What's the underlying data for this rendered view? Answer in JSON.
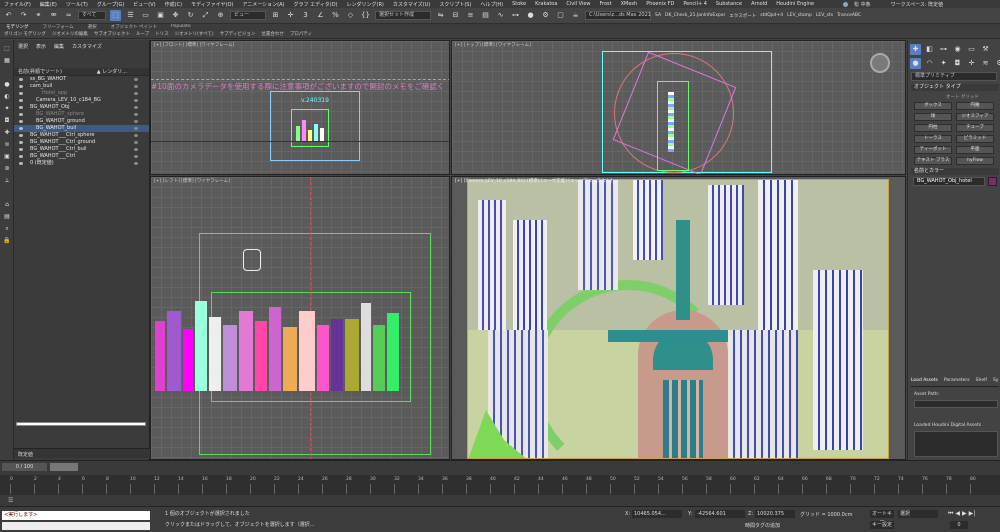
{
  "menu": [
    "ファイル(F)",
    "編集(E)",
    "ツール(T)",
    "グループ(G)",
    "ビュー(V)",
    "作成(C)",
    "モディファイヤ(O)",
    "アニメーション(A)",
    "グラフ エディタ(D)",
    "レンダリング(R)",
    "カスタマイズ(U)",
    "スクリプト(S)",
    "ヘルプ(H)",
    "Stoke",
    "Krakatoa",
    "Civil View",
    "Frost",
    "XMesh",
    "Phoenix FD",
    "Pencil+ 4",
    "Substance",
    "Arnold",
    "Houdini Engine"
  ],
  "user": "松 中条",
  "workspace_label": "ワークスペース: 既定値",
  "toolbar": {
    "filter_value": "すべて",
    "view_value": "ビュー",
    "selection_set_placeholder": "選択セット作成",
    "path_value": "C:\\Users\\z...ds Max 2021",
    "tabs": [
      "SA",
      "DK_Check_21.JanInfoExpor",
      "エクスポート",
      "stdQpd+4",
      "LEV_stamp",
      "LEV_sts",
      "TranceABC"
    ]
  },
  "ribbon": [
    "モデリング",
    "フリーフォーム",
    "選択",
    "オブジェクト ペイント",
    "Populate"
  ],
  "ribbon2": [
    "ポリゴン モデリング",
    "ジオメトリの編集",
    "サブオブジェクト",
    "ループ",
    "トリス",
    "ジオメトリ(すべて)",
    "サブディビジョン",
    "位置合わせ",
    "プロパティ"
  ],
  "explorer": {
    "tabs": [
      "選択",
      "表示",
      "編集",
      "カスタマイズ"
    ],
    "header": "名前(昇順でソート)",
    "header_right": "▲ レンダリ...",
    "rows": [
      {
        "label": "ss_BG_WAHOT",
        "indent": 1,
        "selected": false,
        "eye": true
      },
      {
        "label": "cam_buil",
        "indent": 1,
        "selected": false,
        "eye": true
      },
      {
        "label": "Hotel_app",
        "indent": 3,
        "selected": false,
        "eye": false
      },
      {
        "label": "Camera_LEV_10_c184_BG",
        "indent": 2,
        "selected": false,
        "eye": true
      },
      {
        "label": "BG_WAHOT_Obj",
        "indent": 1,
        "selected": false,
        "eye": true
      },
      {
        "label": "BG_WAHOT_sphere",
        "indent": 2,
        "selected": false,
        "eye": false
      },
      {
        "label": "BG_WAHOT_ground",
        "indent": 2,
        "selected": false,
        "eye": true
      },
      {
        "label": "BG_WAHOT_buil",
        "indent": 2,
        "selected": true,
        "eye": true
      },
      {
        "label": "BG_WAHOT___Ctrl_sphere",
        "indent": 1,
        "selected": false,
        "eye": true
      },
      {
        "label": "BG_WAHOT___Ctrl_ground",
        "indent": 1,
        "selected": false,
        "eye": true
      },
      {
        "label": "BG_WAHOT___Ctrl_buil",
        "indent": 1,
        "selected": false,
        "eye": true
      },
      {
        "label": "BG_WAHOT___Ctrl",
        "indent": 1,
        "selected": false,
        "eye": true
      },
      {
        "label": "0 (既定値)",
        "indent": 1,
        "selected": false,
        "eye": true
      }
    ],
    "layer_label": "既定値"
  },
  "viewports": {
    "front": {
      "label": "[+] [フロント] [標準] [ワイヤフレーム]",
      "warning": "#10面のカメラデータを使用する際に注意事項がございますので開封のメモをご確認く",
      "version": "v.240319"
    },
    "top": {
      "label": "[+] [トップ] [標準] [ワイヤフレーム]"
    },
    "left": {
      "label": "[+] [レフト] [標準] [ワイヤフレーム]"
    },
    "camera": {
      "label": "[+] [Camera_LEV_10_c184_BG] [標準] [ユーザ定義] [エッジフェースなし]"
    }
  },
  "command_panel": {
    "category": "標準プリミティブ",
    "object_type_header": "オブジェクト タイプ",
    "autogrid": "オート グリッド",
    "buttons": [
      "ボックス",
      "円錐",
      "球",
      "ジオスフィア",
      "円柱",
      "チューブ",
      "トーラス",
      "ピラミッド",
      "ティーポット",
      "平面",
      "テキスト プラス",
      "hyFlow"
    ],
    "name_color_header": "名前とカラー",
    "name_value": "BG_WAHOT_Obj_hotel",
    "color": "#7a2c6e",
    "bottom_tabs": [
      "Load Assets",
      "Parameters",
      "Shelf",
      "Sy"
    ],
    "asset_path_label": "Asset Path:",
    "loaded_assets_label": "Loaded Houdini Digital Assets"
  },
  "timeline": {
    "frame_counter": "0 / 100",
    "ticks": [
      "0",
      "2",
      "4",
      "6",
      "8",
      "10",
      "12",
      "14",
      "16",
      "18",
      "20",
      "22",
      "24",
      "26",
      "28",
      "30",
      "32",
      "34",
      "36",
      "38",
      "40",
      "42",
      "44",
      "46",
      "48",
      "50",
      "52",
      "54",
      "56",
      "58",
      "60",
      "62",
      "64",
      "66",
      "68",
      "70",
      "72",
      "74",
      "76",
      "78",
      "80"
    ]
  },
  "status": {
    "script_text": "<実行します>",
    "selected_text": "1 個のオブジェクトが選択されました",
    "hint_text": "クリックまたはドラッグして、オブジェクトを選択します（選択...",
    "x_label": "X:",
    "x_value": "10465.054...",
    "y_label": "Y:",
    "y_value": "-42564.601",
    "z_label": "Z:",
    "z_value": "10020.375",
    "grid_label": "グリッド = 1000.0cm",
    "time_tag": "時間タグの追加",
    "autokey": "オートキー",
    "setkey": "キー設定",
    "selected_filter": "選択",
    "select_layer": "選択セットの設定",
    "play_frame": "0"
  }
}
